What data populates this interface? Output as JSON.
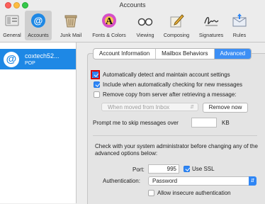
{
  "window": {
    "title": "Accounts"
  },
  "toolbar": {
    "items": [
      {
        "label": "General",
        "icon": "general-icon"
      },
      {
        "label": "Accounts",
        "icon": "at-sign-icon",
        "active": true
      },
      {
        "label": "Junk Mail",
        "icon": "junk-mail-icon"
      },
      {
        "label": "Fonts & Colors",
        "icon": "fonts-colors-icon"
      },
      {
        "label": "Viewing",
        "icon": "glasses-icon"
      },
      {
        "label": "Composing",
        "icon": "pencil-paper-icon"
      },
      {
        "label": "Signatures",
        "icon": "signature-icon"
      },
      {
        "label": "Rules",
        "icon": "rules-icon"
      }
    ]
  },
  "sidebar": {
    "account": {
      "name": "coxtech52...",
      "type": "POP",
      "icon": "at-sign-icon"
    }
  },
  "tabs": [
    {
      "label": "Account Information"
    },
    {
      "label": "Mailbox Behaviors"
    },
    {
      "label": "Advanced",
      "active": true
    }
  ],
  "advanced": {
    "auto_detect": {
      "label": "Automatically detect and maintain account settings",
      "checked": true
    },
    "include_auto_check": {
      "label": "Include when automatically checking for new messages",
      "checked": true
    },
    "remove_copy": {
      "label": "Remove copy from server after retrieving a message:",
      "checked": false
    },
    "remove_when": {
      "value": "When moved from Inbox"
    },
    "remove_now_label": "Remove now",
    "skip_prompt": {
      "label": "Prompt me to skip messages over",
      "value": "",
      "unit": "KB"
    },
    "admin_note": "Check with your system administrator before changing any of the advanced options below:",
    "port": {
      "label": "Port:",
      "value": "995"
    },
    "use_ssl": {
      "label": "Use SSL",
      "checked": true
    },
    "authentication": {
      "label": "Authentication:",
      "value": "Password"
    },
    "allow_insecure": {
      "label": "Allow insecure authentication",
      "checked": false
    }
  },
  "colors": {
    "accent": "#2f86f5",
    "selection": "#1e88e5",
    "highlight_box": "#d60000"
  }
}
